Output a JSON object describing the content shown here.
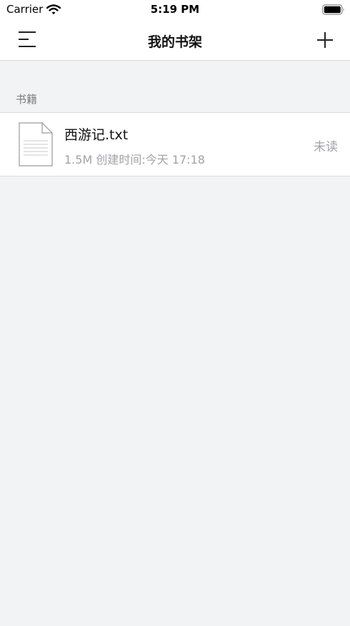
{
  "status_bar": {
    "carrier": "Carrier",
    "time": "5:19 PM",
    "icons": [
      "wifi-icon",
      "battery-icon"
    ]
  },
  "nav": {
    "title": "我的书架",
    "menu_icon": "menu-icon",
    "add_icon": "plus-icon"
  },
  "section": {
    "title": "书籍"
  },
  "books": [
    {
      "title": "西游记.txt",
      "meta": "1.5M 创建时间:今天 17:18",
      "status": "未读",
      "icon": "text-file-icon"
    }
  ],
  "colors": {
    "background": "#f2f3f5",
    "surface": "#ffffff",
    "secondary_text": "#a3a3a7",
    "section_text": "#7a7a7e"
  }
}
